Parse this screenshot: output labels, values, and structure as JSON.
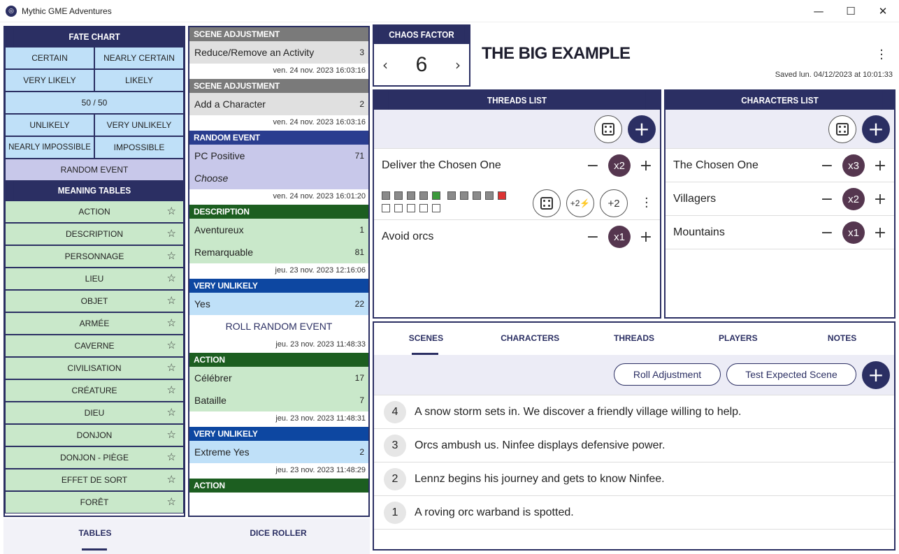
{
  "window": {
    "title": "Mythic GME Adventures",
    "minimize": "—",
    "maximize": "☐",
    "close": "✕"
  },
  "fate_chart": {
    "header": "FATE CHART",
    "odds": [
      "CERTAIN",
      "NEARLY CERTAIN",
      "VERY LIKELY",
      "LIKELY",
      "50 / 50",
      "UNLIKELY",
      "VERY UNLIKELY",
      "NEARLY IMPOSSIBLE",
      "IMPOSSIBLE"
    ],
    "random_event": "RANDOM EVENT"
  },
  "meaning_tables": {
    "header": "MEANING TABLES",
    "items": [
      "ACTION",
      "DESCRIPTION",
      "PERSONNAGE",
      "LIEU",
      "OBJET",
      "ARMÉE",
      "CAVERNE",
      "CIVILISATION",
      "CRÉATURE",
      "DIEU",
      "DONJON",
      "DONJON - PIÈGE",
      "EFFET DE SORT",
      "FORÊT"
    ]
  },
  "log": [
    {
      "type": "SCENE ADJUSTMENT",
      "color": "grey",
      "rows": [
        {
          "text": "Reduce/Remove an Activity",
          "value": "3"
        }
      ],
      "date": "ven. 24 nov. 2023 16:03:16"
    },
    {
      "type": "SCENE ADJUSTMENT",
      "color": "grey",
      "rows": [
        {
          "text": "Add a Character",
          "value": "2"
        }
      ],
      "date": "ven. 24 nov. 2023 16:03:16"
    },
    {
      "type": "RANDOM EVENT",
      "color": "blue",
      "rows": [
        {
          "text": "PC Positive",
          "value": "71"
        },
        {
          "text": "Choose",
          "value": ""
        }
      ],
      "date": "ven. 24 nov. 2023 16:01:20"
    },
    {
      "type": "DESCRIPTION",
      "color": "green",
      "rows": [
        {
          "text": "Aventureux",
          "value": "1"
        },
        {
          "text": "Remarquable",
          "value": "81"
        }
      ],
      "date": "jeu. 23 nov. 2023 12:16:06"
    },
    {
      "type": "VERY UNLIKELY",
      "color": "vblue",
      "rows": [
        {
          "text": "Yes",
          "value": "22"
        }
      ],
      "extra": "ROLL RANDOM EVENT",
      "date": "jeu. 23 nov. 2023 11:48:33"
    },
    {
      "type": "ACTION",
      "color": "green",
      "rows": [
        {
          "text": "Célébrer",
          "value": "17"
        },
        {
          "text": "Bataille",
          "value": "7"
        }
      ],
      "date": "jeu. 23 nov. 2023 11:48:31"
    },
    {
      "type": "VERY UNLIKELY",
      "color": "vblue",
      "rows": [
        {
          "text": "Extreme Yes",
          "value": "2"
        }
      ],
      "date": "jeu. 23 nov. 2023 11:48:29"
    },
    {
      "type": "ACTION",
      "color": "green",
      "rows": [],
      "date": ""
    }
  ],
  "bottom_tabs": [
    "TABLES",
    "DICE ROLLER"
  ],
  "chaos": {
    "header": "CHAOS FACTOR",
    "value": "6",
    "prev": "‹",
    "next": "›"
  },
  "adventure": {
    "title": "THE BIG EXAMPLE",
    "saved": "Saved lun. 04/12/2023 at 10:01:33"
  },
  "threads": {
    "header": "THREADS LIST",
    "items": [
      {
        "name": "Deliver the Chosen One",
        "weight": "x2"
      },
      {
        "name": "Avoid orcs",
        "weight": "x1"
      }
    ],
    "progress_buttons": [
      "+2⚡",
      "+2"
    ]
  },
  "characters": {
    "header": "CHARACTERS LIST",
    "items": [
      {
        "name": "The Chosen One",
        "weight": "x3"
      },
      {
        "name": "Villagers",
        "weight": "x2"
      },
      {
        "name": "Mountains",
        "weight": "x1"
      }
    ]
  },
  "scenes_panel": {
    "tabs": [
      "SCENES",
      "CHARACTERS",
      "THREADS",
      "PLAYERS",
      "NOTES"
    ],
    "roll_adjustment": "Roll Adjustment",
    "test_expected": "Test Expected Scene",
    "scenes": [
      {
        "num": "4",
        "text": "A snow storm sets in. We discover a friendly village willing to help."
      },
      {
        "num": "3",
        "text": "Orcs ambush us. Ninfee displays defensive power."
      },
      {
        "num": "2",
        "text": "Lennz begins his journey and gets to know Ninfee."
      },
      {
        "num": "1",
        "text": "A roving orc warband is spotted."
      }
    ]
  },
  "colors": {
    "primary": "#2b2f63",
    "fate": "#bfe0f8",
    "meaning": "#c9e8ca",
    "badge": "#55364f"
  }
}
